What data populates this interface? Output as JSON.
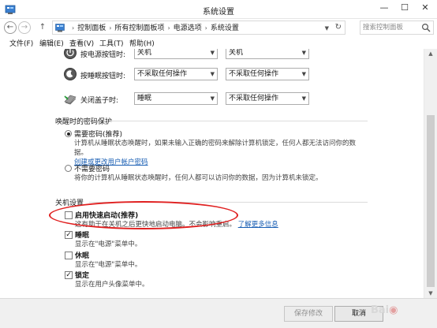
{
  "window": {
    "title": "系统设置",
    "min": "—",
    "max": "☐",
    "close": "✕"
  },
  "address": {
    "crumbs": [
      "控制面板",
      "所有控制面板项",
      "电源选项",
      "系统设置"
    ],
    "search_placeholder": "搜索控制面板"
  },
  "menu": [
    "文件(F)",
    "编辑(E)",
    "查看(V)",
    "工具(T)",
    "帮助(H)"
  ],
  "power_rows": [
    {
      "label": "按电源按钮时:",
      "battery": "关机",
      "plugged": "关机"
    },
    {
      "label": "按睡眠按钮时:",
      "battery": "不采取任何操作",
      "plugged": "不采取任何操作"
    },
    {
      "label": "关闭盖子时:",
      "battery": "睡眠",
      "plugged": "不采取任何操作"
    }
  ],
  "password_section": {
    "title": "唤醒时的密码保护",
    "require": {
      "label": "需要密码(推荐)",
      "desc_line1": "计算机从睡眠状态唤醒时，如果未输入正确的密码来解除计算机锁定，任何人都无法访问你的数",
      "desc_line2": "据。",
      "link": "创建或更改用户帐户密码"
    },
    "no_require": {
      "label": "不需要密码",
      "desc": "将你的计算机从睡眠状态唤醒时，任何人都可以访问你的数据，因为计算机未锁定。"
    }
  },
  "shutdown_section": {
    "title": "关机设置",
    "items": [
      {
        "label": "启用快速启动(推荐)",
        "desc": "这有助于在关机之后更快地启动电脑。不会影响重启。",
        "link": "了解更多信息",
        "checked": false
      },
      {
        "label": "睡眠",
        "desc": "显示在\"电源\"菜单中。",
        "checked": true
      },
      {
        "label": "休眠",
        "desc": "显示在\"电源\"菜单中。",
        "checked": false
      },
      {
        "label": "锁定",
        "desc": "显示在用户头像菜单中。",
        "checked": true
      }
    ]
  },
  "footer": {
    "save": "保存修改",
    "cancel": "取消"
  },
  "check_mark": "✓"
}
